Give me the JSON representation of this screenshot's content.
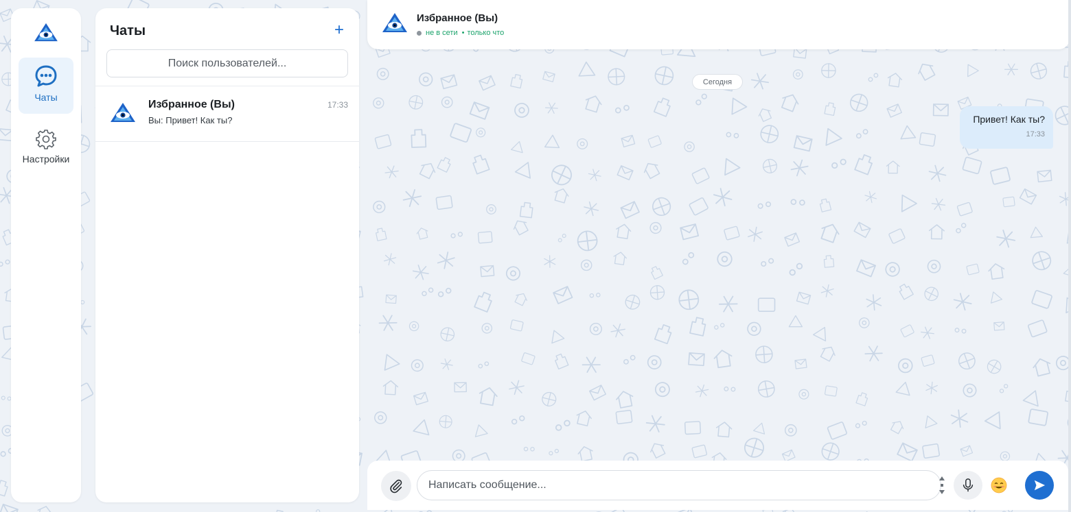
{
  "sidebar": {
    "logo_icon": "eye-pyramid-logo-icon",
    "items": [
      {
        "label": "Чаты",
        "icon": "chat-bubble-icon",
        "active": true
      },
      {
        "label": "Настройки",
        "icon": "gear-icon",
        "active": false
      }
    ]
  },
  "chats_panel": {
    "title": "Чаты",
    "add_label": "+",
    "search_placeholder": "Поиск пользователей...",
    "items": [
      {
        "name": "Избранное (Вы)",
        "time": "17:33",
        "preview": "Вы: Привет! Как ты?"
      }
    ]
  },
  "chat_header": {
    "name": "Избранное (Вы)",
    "status": "не в сети",
    "separator": "•",
    "last_seen": "только что"
  },
  "conversation": {
    "date_label": "Сегодня",
    "messages": [
      {
        "text": "Привет! Как ты?",
        "time": "17:33",
        "outgoing": true
      }
    ]
  },
  "composer": {
    "placeholder": "Написать сообщение...",
    "attach_icon": "paperclip-icon",
    "mic_icon": "microphone-icon",
    "emoji_icon": "smiley-emoji-icon",
    "send_icon": "send-arrow-icon"
  },
  "colors": {
    "accent": "#1f6fd1",
    "active_nav_bg": "#eaf3fc",
    "outgoing_bubble": "#dcecfb",
    "status_green": "#1ba36b",
    "wallpaper": "#eef2f7"
  }
}
